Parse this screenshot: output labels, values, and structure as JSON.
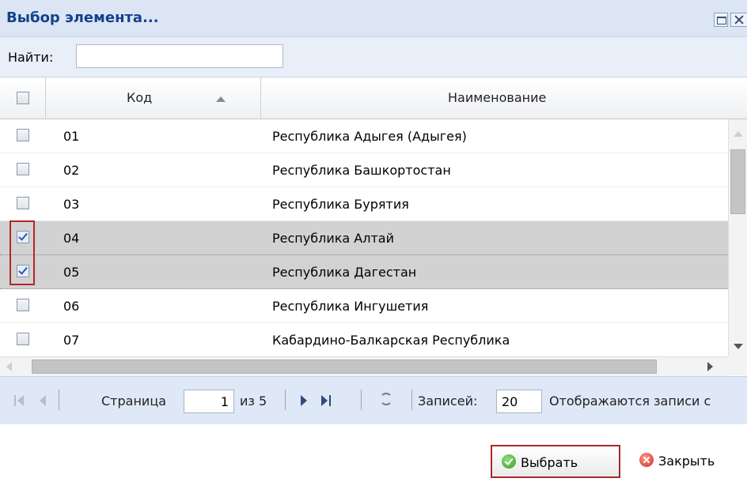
{
  "window": {
    "title": "Выбор элемента..."
  },
  "search": {
    "label": "Найти:",
    "value": ""
  },
  "grid": {
    "columns": {
      "code": "Код",
      "name": "Наименование"
    },
    "rows": [
      {
        "code": "01",
        "name": "Республика Адыгея (Адыгея)",
        "checked": false
      },
      {
        "code": "02",
        "name": "Республика Башкортостан",
        "checked": false
      },
      {
        "code": "03",
        "name": "Республика Бурятия",
        "checked": false
      },
      {
        "code": "04",
        "name": "Республика Алтай",
        "checked": true
      },
      {
        "code": "05",
        "name": "Республика Дагестан",
        "checked": true
      },
      {
        "code": "06",
        "name": "Республика Ингушетия",
        "checked": false
      },
      {
        "code": "07",
        "name": "Кабардино-Балкарская Республика",
        "checked": false
      }
    ]
  },
  "pager": {
    "page_label": "Страница",
    "page_value": "1",
    "of_label": "из 5",
    "records_label": "Записей:",
    "records_value": "20",
    "display_text": "Отображаются записи с"
  },
  "buttons": {
    "select": "Выбрать",
    "close": "Закрыть"
  },
  "colors": {
    "selected_row": "#d2d2d2",
    "highlight_border": "#b32626",
    "header_text": "#15428b"
  }
}
